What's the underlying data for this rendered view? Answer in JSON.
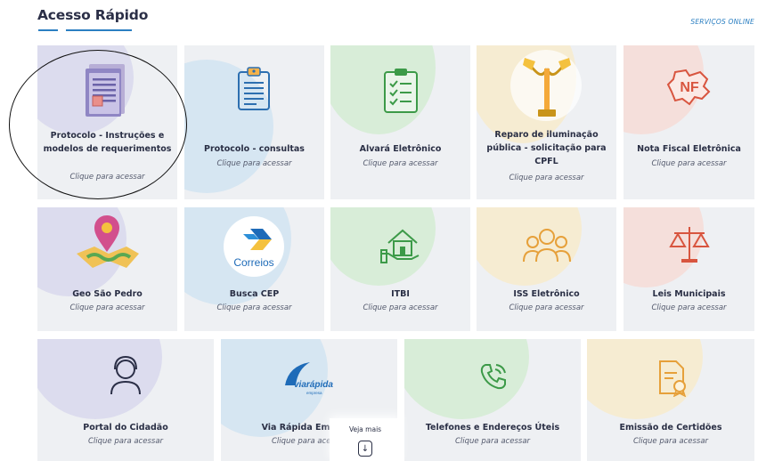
{
  "header": {
    "title": "Acesso Rápido",
    "services_link": "SERVIÇOS ONLINE"
  },
  "cards": [
    {
      "name": "protocolo-instrucoes",
      "label": "Protocolo - Instruções e modelos de requerimentos",
      "sub": "Clique para acessar",
      "icon": "document-icon"
    },
    {
      "name": "protocolo-consultas",
      "label": "Protocolo - consultas",
      "sub": "Clique para acessar",
      "icon": "clipboard-icon"
    },
    {
      "name": "alvara-eletronico",
      "label": "Alvará Eletrônico",
      "sub": "Clique para acessar",
      "icon": "checklist-icon"
    },
    {
      "name": "reparo-iluminacao",
      "label": "Reparo de iluminação pública - solicitação para CPFL",
      "sub": "Clique para acessar",
      "icon": "streetlight-icon"
    },
    {
      "name": "nota-fiscal",
      "label": "Nota Fiscal Eletrônica",
      "sub": "Clique para acessar",
      "icon": "nota-fiscal-icon",
      "icon_text": "NF"
    },
    {
      "name": "geo-sao-pedro",
      "label": "Geo São Pedro",
      "sub": "Clique para acessar",
      "icon": "map-pin-icon"
    },
    {
      "name": "busca-cep",
      "label": "Busca CEP",
      "sub": "Clique para acessar",
      "icon": "correios-logo",
      "icon_text": "Correios"
    },
    {
      "name": "itbi",
      "label": "ITBI",
      "sub": "Clique para acessar",
      "icon": "house-hand-icon"
    },
    {
      "name": "iss-eletronico",
      "label": "ISS Eletrônico",
      "sub": "Clique para acessar",
      "icon": "people-icon"
    },
    {
      "name": "leis-municipais",
      "label": "Leis Municipais",
      "sub": "Clique para acessar",
      "icon": "scales-icon"
    },
    {
      "name": "portal-cidadao",
      "label": "Portal do Cidadão",
      "sub": "Clique para acessar",
      "icon": "agent-icon"
    },
    {
      "name": "via-rapida",
      "label": "Via Rápida Empresa",
      "sub": "Clique para acessar",
      "icon": "via-rapida-logo",
      "icon_text": "viarápida",
      "icon_subtext": "empresa"
    },
    {
      "name": "telefones",
      "label": "Telefones e Endereços Úteis",
      "sub": "Clique para acessar",
      "icon": "phone-icon"
    },
    {
      "name": "certidoes",
      "label": "Emissão de Certidões",
      "sub": "Clique para acessar",
      "icon": "certificate-icon"
    }
  ],
  "veja_mais": {
    "label": "Veja mais",
    "icon": "arrow-down-icon"
  },
  "colors": {
    "accent": "#2b7fc2",
    "card_bg": "#eef0f3",
    "blob_purple": "#dcdcee",
    "blob_blue": "#d6e6f2",
    "blob_green": "#d8edd8",
    "blob_yellow": "#f6ecd2",
    "blob_pink": "#f5dfdb"
  }
}
